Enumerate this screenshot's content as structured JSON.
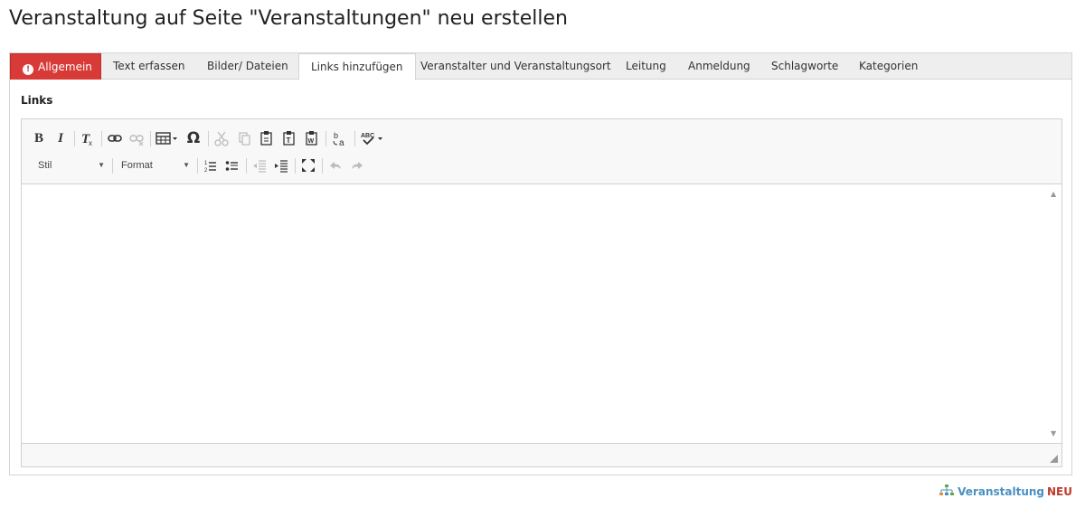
{
  "page": {
    "title": "Veranstaltung auf Seite \"Veranstaltungen\" neu erstellen"
  },
  "tabs": [
    {
      "label": "Allgemein",
      "state": "error"
    },
    {
      "label": "Text erfassen",
      "state": "normal"
    },
    {
      "label": "Bilder/ Dateien",
      "state": "normal"
    },
    {
      "label": "Links hinzufügen",
      "state": "active"
    },
    {
      "label": "Veranstalter und Veranstaltungsort",
      "state": "normal"
    },
    {
      "label": "Leitung",
      "state": "normal"
    },
    {
      "label": "Anmeldung",
      "state": "normal"
    },
    {
      "label": "Schlagworte",
      "state": "normal"
    },
    {
      "label": "Kategorien",
      "state": "normal"
    }
  ],
  "section": {
    "label": "Links"
  },
  "toolbar": {
    "row1_icons": [
      "bold-icon",
      "italic-icon",
      "remove-format-icon",
      "link-icon",
      "unlink-icon",
      "table-icon",
      "special-char-icon",
      "cut-icon",
      "copy-icon",
      "paste-icon",
      "paste-text-icon",
      "paste-word-icon",
      "find-replace-icon",
      "spellcheck-icon"
    ],
    "row2_icons": [
      "numbered-list-icon",
      "bulleted-list-icon",
      "outdent-icon",
      "indent-icon",
      "maximize-icon",
      "undo-icon",
      "redo-icon"
    ],
    "bold_glyph": "B",
    "italic_glyph": "I",
    "style_combo": "Stil",
    "format_combo": "Format"
  },
  "footer": {
    "link_name": "Veranstaltung",
    "badge": "NEU"
  },
  "colors": {
    "error_tab": "#d73a37",
    "link": "#4a90c2",
    "badge": "#c0392b"
  }
}
